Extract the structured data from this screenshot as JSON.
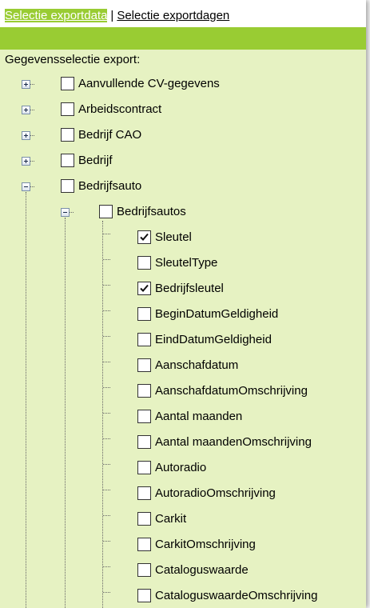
{
  "tabs": {
    "export_data": "Selectie exportdata",
    "separator": "|",
    "export_days": "Selectie exportdagen"
  },
  "section_title": "Gegevensselectie export:",
  "tree": {
    "groups": [
      {
        "label": "Aanvullende CV-gegevens",
        "checked": false,
        "expanded": false
      },
      {
        "label": "Arbeidscontract",
        "checked": false,
        "expanded": false
      },
      {
        "label": "Bedrijf CAO",
        "checked": false,
        "expanded": false
      },
      {
        "label": "Bedrijf",
        "checked": false,
        "expanded": false
      },
      {
        "label": "Bedrijfsauto",
        "checked": false,
        "expanded": true
      }
    ],
    "subgroup": {
      "label": "Bedrijfsautos",
      "checked": false,
      "expanded": true
    },
    "fields": [
      {
        "label": "Sleutel",
        "checked": true
      },
      {
        "label": "SleutelType",
        "checked": false
      },
      {
        "label": "Bedrijfsleutel",
        "checked": true
      },
      {
        "label": "BeginDatumGeldigheid",
        "checked": false
      },
      {
        "label": "EindDatumGeldigheid",
        "checked": false
      },
      {
        "label": "Aanschafdatum",
        "checked": false
      },
      {
        "label": "AanschafdatumOmschrijving",
        "checked": false
      },
      {
        "label": "Aantal maanden",
        "checked": false
      },
      {
        "label": "Aantal maandenOmschrijving",
        "checked": false
      },
      {
        "label": "Autoradio",
        "checked": false
      },
      {
        "label": "AutoradioOmschrijving",
        "checked": false
      },
      {
        "label": "Carkit",
        "checked": false
      },
      {
        "label": "CarkitOmschrijving",
        "checked": false
      },
      {
        "label": "Cataloguswaarde",
        "checked": false
      },
      {
        "label": "CataloguswaardeOmschrijving",
        "checked": false
      }
    ]
  }
}
